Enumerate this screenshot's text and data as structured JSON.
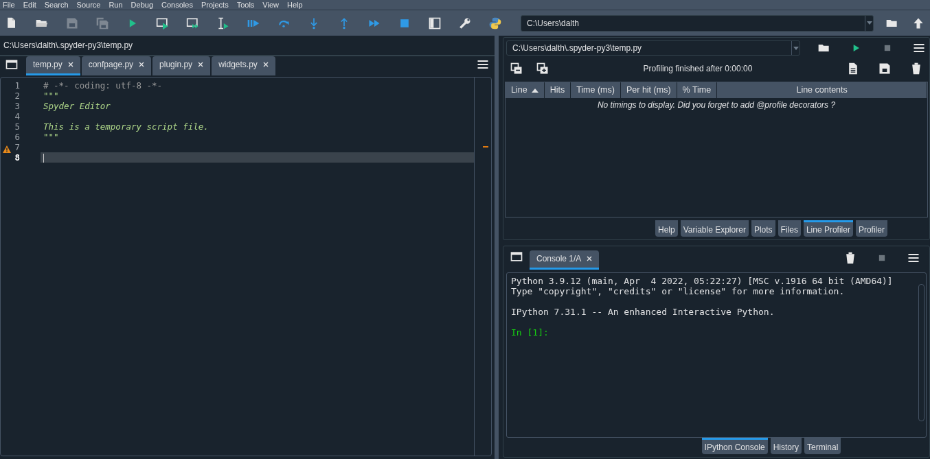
{
  "menu": [
    "File",
    "Edit",
    "Search",
    "Source",
    "Run",
    "Debug",
    "Consoles",
    "Projects",
    "Tools",
    "View",
    "Help"
  ],
  "toolbar": [
    {
      "kind": "new-file",
      "disabled": false
    },
    {
      "kind": "open",
      "disabled": false
    },
    {
      "kind": "save",
      "disabled": true
    },
    {
      "kind": "save-all",
      "disabled": true
    },
    {
      "kind": "run",
      "disabled": false
    },
    {
      "kind": "run-cell",
      "disabled": false
    },
    {
      "kind": "run-cell-advance",
      "disabled": false
    },
    {
      "kind": "run-selection",
      "disabled": false
    },
    {
      "kind": "debug",
      "disabled": false
    },
    {
      "kind": "step-over",
      "disabled": false
    },
    {
      "kind": "step-into",
      "disabled": false
    },
    {
      "kind": "step-return",
      "disabled": false
    },
    {
      "kind": "continue",
      "disabled": false
    },
    {
      "kind": "stop",
      "disabled": false
    },
    {
      "kind": "maximize",
      "disabled": false
    },
    {
      "kind": "preferences",
      "disabled": false
    },
    {
      "kind": "python-path",
      "disabled": false
    }
  ],
  "working_directory": "C:\\Users\\dalth",
  "editor": {
    "path": "C:\\Users\\dalth\\.spyder-py3\\temp.py",
    "tabs": [
      {
        "label": "temp.py",
        "selected": true
      },
      {
        "label": "confpage.py",
        "selected": false
      },
      {
        "label": "plugin.py",
        "selected": false
      },
      {
        "label": "widgets.py",
        "selected": false
      }
    ],
    "lines": [
      {
        "number": "1",
        "kind": "comment",
        "text": "# -*- coding: utf-8 -*-",
        "warning": false,
        "current": false
      },
      {
        "number": "2",
        "kind": "string",
        "text": "\"\"\"",
        "warning": false,
        "current": false
      },
      {
        "number": "3",
        "kind": "docstring",
        "text": "Spyder Editor",
        "warning": false,
        "current": false
      },
      {
        "number": "4",
        "kind": "blank",
        "warning": false,
        "current": false
      },
      {
        "number": "5",
        "kind": "docstring",
        "text": "This is a temporary script file.",
        "warning": false,
        "current": false
      },
      {
        "number": "6",
        "kind": "string",
        "text": "\"\"\"",
        "warning": false,
        "current": false
      },
      {
        "number": "7",
        "kind": "blank",
        "warning": true,
        "current": false
      },
      {
        "number": "8",
        "kind": "blank",
        "warning": false,
        "current": true
      }
    ]
  },
  "profiler": {
    "file": "C:\\Users\\dalth\\.spyder-py3\\temp.py",
    "status": "Profiling finished after 0:00:00",
    "columns": [
      {
        "label": "Line",
        "sorted": true
      },
      {
        "label": "Hits",
        "sorted": false
      },
      {
        "label": "Time (ms)",
        "sorted": false
      },
      {
        "label": "Per hit (ms)",
        "sorted": false
      },
      {
        "label": "% Time",
        "sorted": false
      },
      {
        "label": "Line contents",
        "sorted": false
      }
    ],
    "message": "No timings to display. Did you forget to add @profile decorators ?",
    "pane_tabs": [
      {
        "label": "Help",
        "selected": false
      },
      {
        "label": "Variable Explorer",
        "selected": false
      },
      {
        "label": "Plots",
        "selected": false
      },
      {
        "label": "Files",
        "selected": false
      },
      {
        "label": "Line Profiler",
        "selected": true
      },
      {
        "label": "Profiler",
        "selected": false
      }
    ]
  },
  "console": {
    "tabs": [
      {
        "label": "Console 1/A",
        "selected": true
      }
    ],
    "paragraphs": [
      [
        "Python 3.9.12 (main, Apr  4 2022, 05:22:27) [MSC v.1916 64 bit (AMD64)]",
        "Type \"copyright\", \"credits\" or \"license\" for more information."
      ],
      [
        "IPython 7.31.1 -- An enhanced Interactive Python."
      ]
    ],
    "prompt": "In [1]:",
    "pane_tabs": [
      {
        "label": "IPython Console",
        "selected": true
      },
      {
        "label": "History",
        "selected": false
      },
      {
        "label": "Terminal",
        "selected": false
      }
    ]
  }
}
